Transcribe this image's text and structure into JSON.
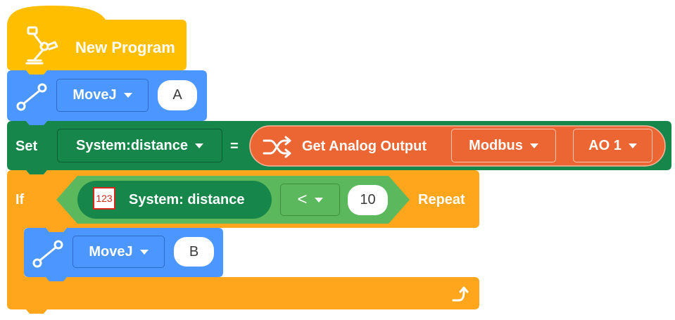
{
  "colors": {
    "hat": "#FFBF00",
    "motion": "#4C97FF",
    "variable": "#16864A",
    "sensor": "#EC6633",
    "control": "#FFA61C",
    "operator": "#5CB85C"
  },
  "hat_block": {
    "title": "New Program",
    "icon": "robot-arm-icon"
  },
  "move_a": {
    "icon": "path-line-icon",
    "command": "MoveJ",
    "target": "A"
  },
  "set_block": {
    "keyword": "Set",
    "variable": "System:distance",
    "equals": "=",
    "reporter": {
      "icon": "shuffle-icon",
      "label": "Get Analog Output",
      "source": "Modbus",
      "port": "AO 1"
    }
  },
  "if_block": {
    "keyword": "If",
    "condition": {
      "badge": "123",
      "variable": "System:  distance",
      "operator": "<",
      "value": "10"
    },
    "trailing": "Repeat",
    "loop_icon": "loop-arrow-icon"
  },
  "move_b": {
    "icon": "path-line-icon",
    "command": "MoveJ",
    "target": "B"
  }
}
